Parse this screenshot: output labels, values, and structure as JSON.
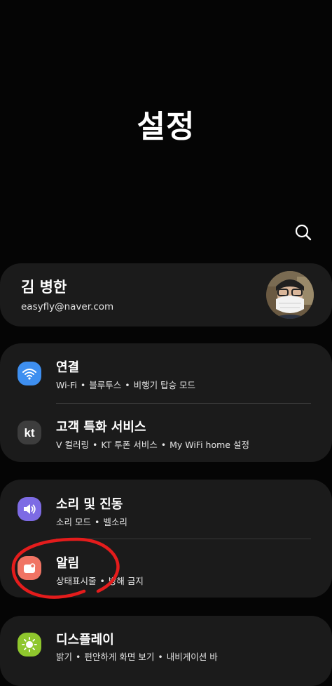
{
  "header": {
    "title": "설정"
  },
  "toolbar": {
    "search_icon": "search-icon"
  },
  "profile": {
    "name": "김 병한",
    "email": "easyfly@naver.com"
  },
  "settings": [
    {
      "title": "연결",
      "sub": [
        "Wi-Fi",
        "블루투스",
        "비행기 탑승 모드"
      ],
      "icon": "wifi-icon",
      "color": "#3e8ff0"
    },
    {
      "title": "고객 특화 서비스",
      "sub": [
        "V 컬러링",
        "KT 투폰 서비스",
        "My WiFi home 설정"
      ],
      "icon": "kt-logo-icon",
      "color": "#3d3d3d"
    },
    {
      "title": "소리 및 진동",
      "sub": [
        "소리 모드",
        "벨소리"
      ],
      "icon": "speaker-icon",
      "color": "#7d6be4"
    },
    {
      "title": "알림",
      "sub": [
        "상태표시줄",
        "방해 금지"
      ],
      "icon": "notification-icon",
      "color": "#f07464"
    },
    {
      "title": "디스플레이",
      "sub": [
        "밝기",
        "편안하게 화면 보기",
        "내비게이션 바"
      ],
      "icon": "sun-icon",
      "color": "#8fc72d"
    }
  ],
  "annotation_color": "#e41c1c"
}
